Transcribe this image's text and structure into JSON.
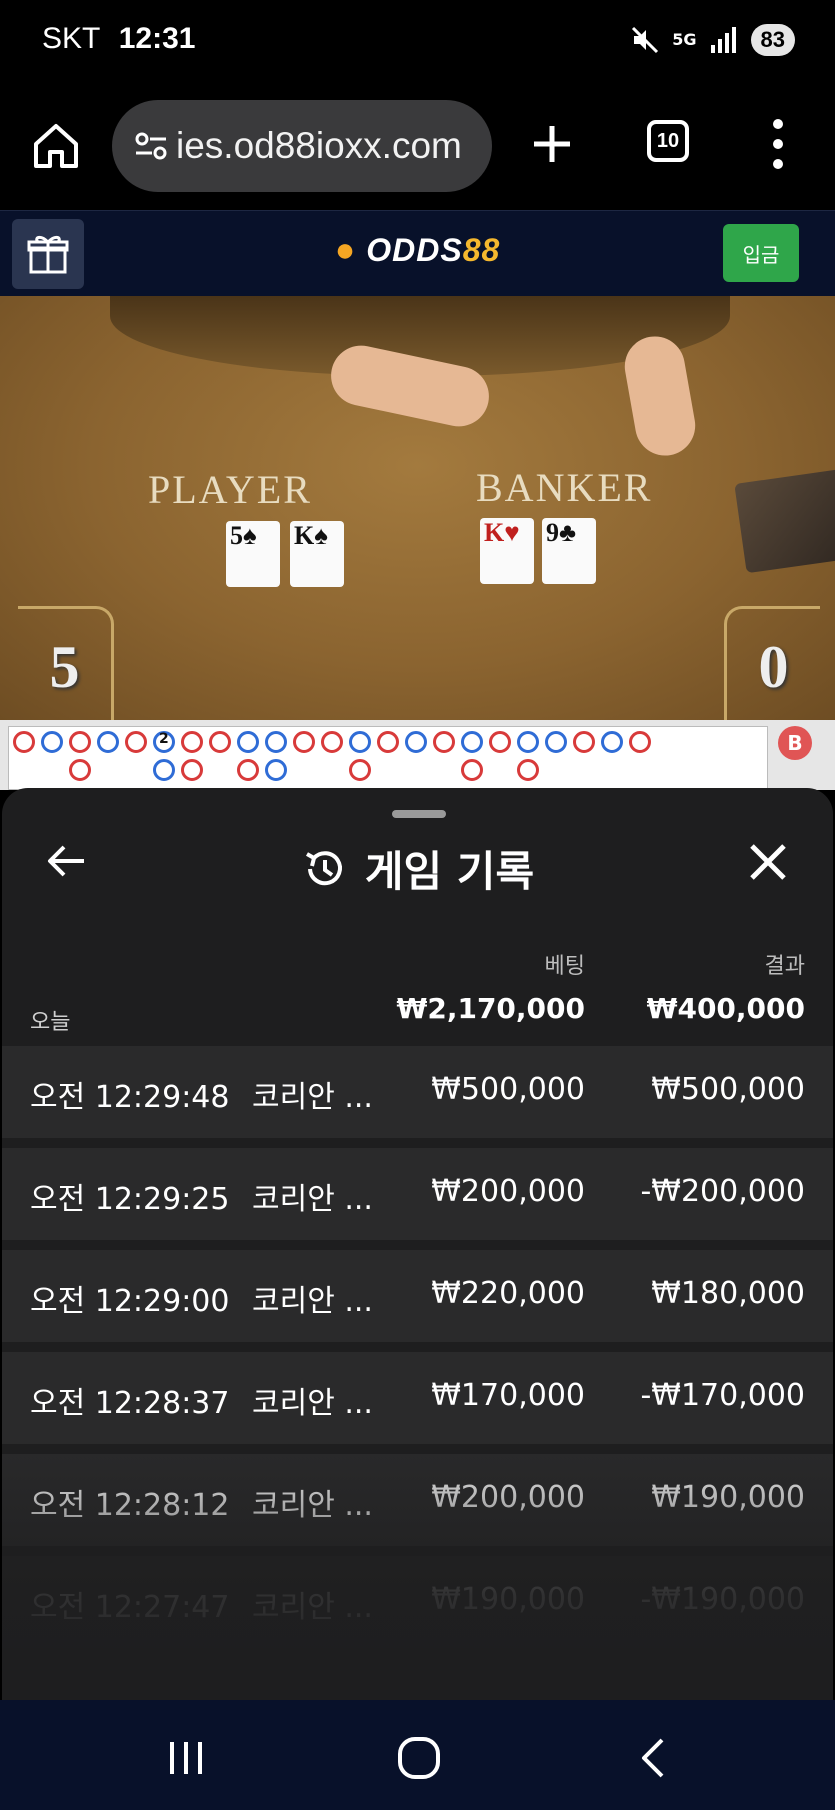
{
  "status_bar": {
    "carrier": "SKT",
    "time": "12:31",
    "network": "5G",
    "battery": "83"
  },
  "browser": {
    "url": "ies.od88ioxx.com",
    "tab_count": "10"
  },
  "site": {
    "logo_left": "ODDS",
    "logo_right": "88",
    "deposit_label": "입금",
    "brand_green": "#2fa64a",
    "brand_gold": "#f5b82e"
  },
  "game": {
    "player_label": "PLAYER",
    "banker_label": "BANKER",
    "player_cards": [
      {
        "rank": "5",
        "suit": "♠",
        "color": "black"
      },
      {
        "rank": "K",
        "suit": "♠",
        "color": "black"
      }
    ],
    "banker_cards": [
      {
        "rank": "K",
        "suit": "♥",
        "color": "red"
      },
      {
        "rank": "9",
        "suit": "♣",
        "color": "black"
      }
    ],
    "player_score": "5",
    "banker_score": "0",
    "road_badge": "B",
    "road_marker": "2"
  },
  "history": {
    "title": "게임 기록",
    "col_bet": "베팅",
    "col_result": "결과",
    "today_label": "오늘",
    "total_bet": "₩2,170,000",
    "total_result": "₩400,000",
    "rows": [
      {
        "time": "오전 12:29:48",
        "game": "코리안 ...",
        "bet": "₩500,000",
        "result": "₩500,000"
      },
      {
        "time": "오전 12:29:25",
        "game": "코리안 ...",
        "bet": "₩200,000",
        "result": "-₩200,000"
      },
      {
        "time": "오전 12:29:00",
        "game": "코리안 ...",
        "bet": "₩220,000",
        "result": "₩180,000"
      },
      {
        "time": "오전 12:28:37",
        "game": "코리안 ...",
        "bet": "₩170,000",
        "result": "-₩170,000"
      },
      {
        "time": "오전 12:28:12",
        "game": "코리안 ...",
        "bet": "₩200,000",
        "result": "₩190,000"
      },
      {
        "time": "오전 12:27:47",
        "game": "코리안 ...",
        "bet": "₩190,000",
        "result": "-₩190,000"
      }
    ]
  }
}
